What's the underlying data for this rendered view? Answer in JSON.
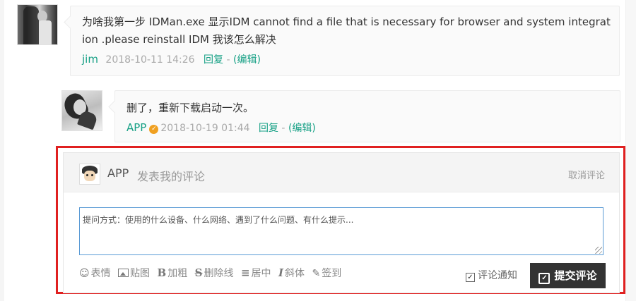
{
  "comments": [
    {
      "author": "jim",
      "text": "为啥我第一步 IDMan.exe 显示IDM cannot find a file that is necessary for browser and system integration .please reinstall IDM 我该怎么解决",
      "time": "2018-10-11 14:26",
      "reply_label": "回复",
      "separator": " - ",
      "edit_label": "(编辑)"
    },
    {
      "author": "APP",
      "text": "删了，重新下载启动一次。",
      "time": "2018-10-19 01:44",
      "reply_label": "回复",
      "separator": " - ",
      "edit_label": "(编辑)",
      "verified_icon": "verified-badge-icon"
    }
  ],
  "comment_form": {
    "user": "APP",
    "hint": "发表我的评论",
    "cancel_label": "取消评论",
    "placeholder": "提问方式：使用的什么设备、什么网络、遇到了什么问题、有什么提示...",
    "toolbar": [
      {
        "icon": "smile-icon",
        "label": "表情"
      },
      {
        "icon": "image-icon",
        "label": "贴图"
      },
      {
        "icon": "bold-icon",
        "label": "加粗"
      },
      {
        "icon": "strikethrough-icon",
        "label": "删除线"
      },
      {
        "icon": "align-center-icon",
        "label": "居中"
      },
      {
        "icon": "italic-icon",
        "label": "斜体"
      },
      {
        "icon": "sign-in-icon",
        "label": "签到"
      }
    ],
    "notify_label": "评论通知",
    "notify_checked": true,
    "submit_label": "提交评论"
  },
  "colors": {
    "link": "#16a085",
    "highlight_border": "#e02020",
    "submit_bg": "#333333"
  }
}
